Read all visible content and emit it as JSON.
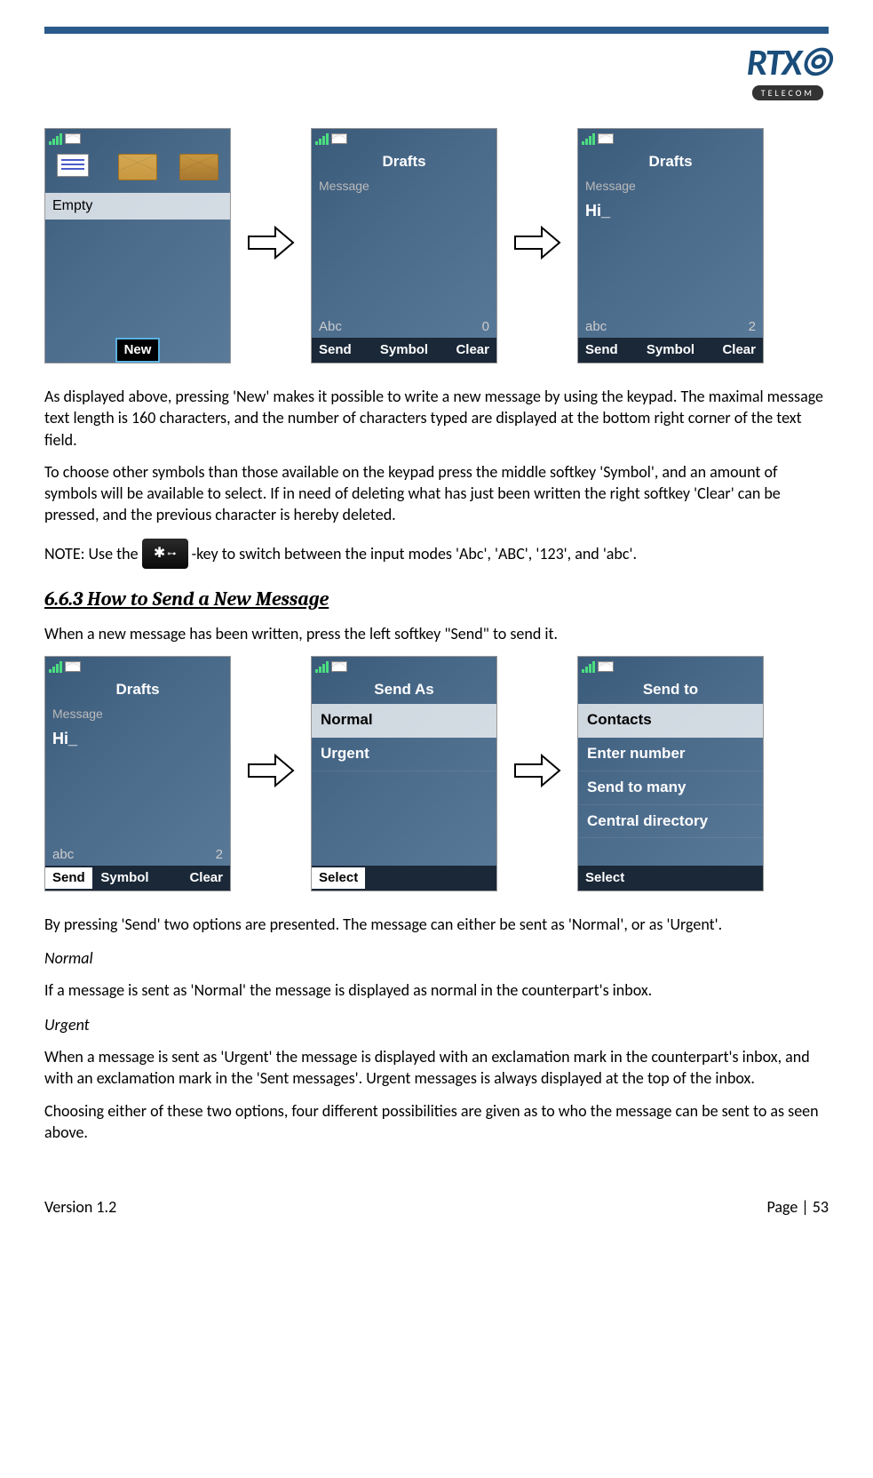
{
  "logo": {
    "main": "RTX",
    "sub": "TELECOM"
  },
  "row1": {
    "screen1": {
      "empty": "Empty",
      "softkey": "New"
    },
    "screen2": {
      "title": "Drafts",
      "subtitle": "Message",
      "mode": "Abc",
      "count": "0",
      "sk_left": "Send",
      "sk_mid": "Symbol",
      "sk_right": "Clear"
    },
    "screen3": {
      "title": "Drafts",
      "subtitle": "Message",
      "input": "Hi_",
      "mode": "abc",
      "count": "2",
      "sk_left": "Send",
      "sk_mid": "Symbol",
      "sk_right": "Clear"
    }
  },
  "para1": "As displayed above, pressing 'New' makes it possible to write a new message by using the keypad. The maximal message text length is 160 characters, and the number of characters typed are displayed at the bottom right corner of the text field.",
  "para2": "To choose other symbols than those available on the keypad press the middle softkey 'Symbol', and an amount of symbols will be available to select.  If in need of deleting what has just been written the right softkey 'Clear' can be pressed, and the previous character is hereby deleted.",
  "note_pre": "NOTE: Use the ",
  "note_post": "-key to switch between the input modes 'Abc', 'ABC', '123', and 'abc'.",
  "heading": "6.6.3 How to Send a New Message",
  "para3": "When a new message has been written, press the left softkey \"Send\" to send it.",
  "row2": {
    "screen1": {
      "title": "Drafts",
      "subtitle": "Message",
      "input": "Hi_",
      "mode": "abc",
      "count": "2",
      "sk_left": "Send",
      "sk_mid": "Symbol",
      "sk_right": "Clear"
    },
    "screen2": {
      "title": "Send As",
      "items": [
        "Normal",
        "Urgent"
      ],
      "selected_index": 0,
      "sk": "Select"
    },
    "screen3": {
      "title": "Send to",
      "items": [
        "Contacts",
        "Enter number",
        "Send to many",
        "Central directory"
      ],
      "selected_index": 0,
      "sk": "Select"
    }
  },
  "para4": "By pressing 'Send' two options are presented. The message can either be sent as 'Normal', or as 'Urgent'.",
  "normal_head": "Normal",
  "normal_body": "If a message is sent as 'Normal' the message is displayed as normal in the counterpart's inbox.",
  "urgent_head": "Urgent",
  "urgent_body": "When a message is sent as 'Urgent' the message is displayed with an exclamation mark in the counterpart's inbox, and with an exclamation mark in the 'Sent messages'.  Urgent messages is always displayed at the top of the inbox.",
  "para5": "Choosing either of these two options, four different possibilities are given as to who the message can be sent to as seen above.",
  "footer": {
    "version": "Version 1.2",
    "page": "Page | 53"
  }
}
